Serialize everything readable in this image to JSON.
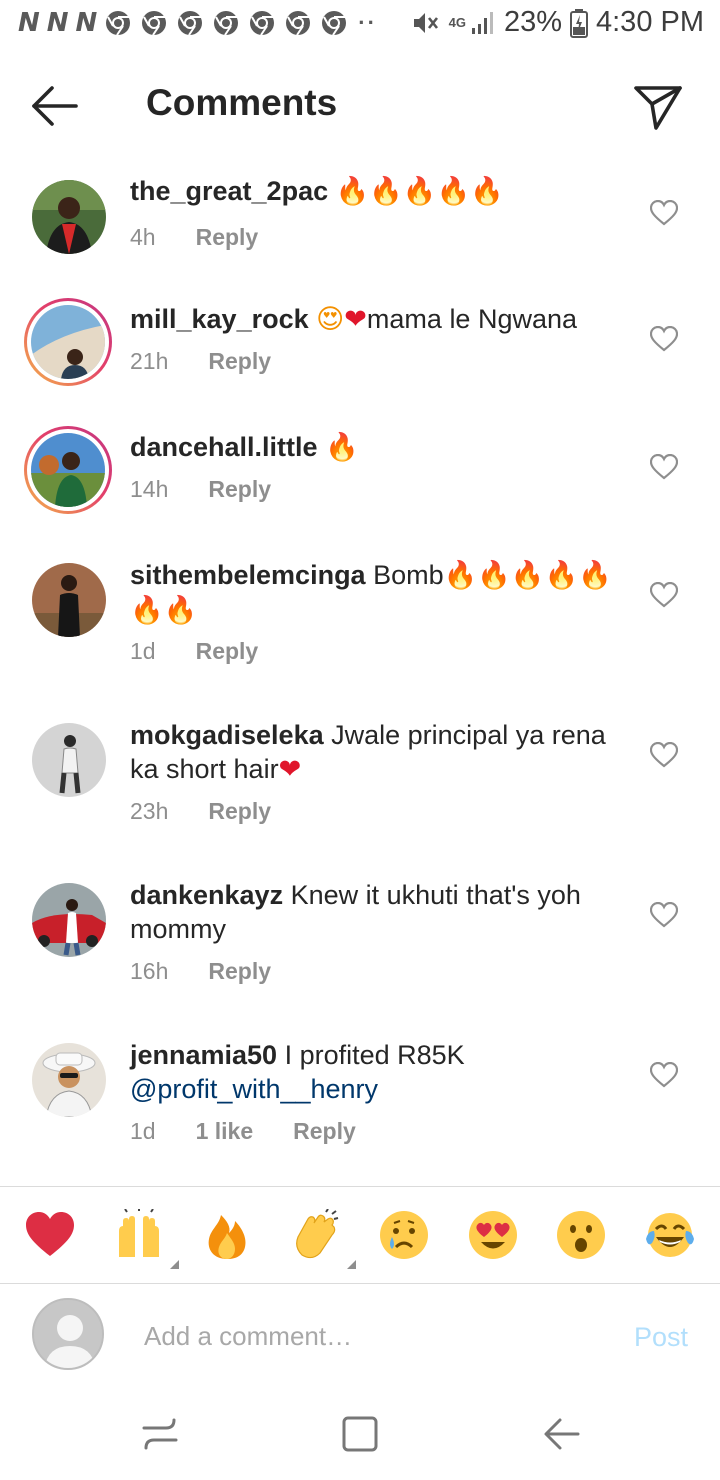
{
  "status_bar": {
    "notification_letters": [
      "N",
      "N",
      "N"
    ],
    "chrome_icon_count": 7,
    "network": "4G",
    "battery": "23%",
    "time": "4:30 PM"
  },
  "header": {
    "title": "Comments"
  },
  "comments": [
    {
      "username": "the_great_2pac",
      "text": "",
      "emoji": "🔥🔥🔥🔥🔥",
      "time": "4h",
      "reply": "Reply"
    },
    {
      "username": "mill_kay_rock",
      "text_pre_emoji": "😍",
      "heart": "❤",
      "text": "mama le Ngwana",
      "time": "21h",
      "reply": "Reply"
    },
    {
      "username": "dancehall.little",
      "text": "",
      "emoji": "🔥",
      "time": "14h",
      "reply": "Reply"
    },
    {
      "username": "sithembelemcinga",
      "text": "Bomb",
      "emoji": "🔥🔥🔥🔥🔥🔥🔥",
      "time": "1d",
      "reply": "Reply"
    },
    {
      "username": "mokgadiseleka",
      "text": "Jwale principal ya rena ka short hair",
      "heart": "❤",
      "time": "23h",
      "reply": "Reply"
    },
    {
      "username": "dankenkayz",
      "text": "Knew it ukhuti that's yoh mommy",
      "time": "16h",
      "reply": "Reply"
    },
    {
      "username": "jennamia50",
      "text": "I profited R85K",
      "mention": "@profit_with__henry",
      "time": "1d",
      "likes": "1 like",
      "reply": "Reply"
    }
  ],
  "emoji_bar": [
    "red-heart",
    "raising-hands",
    "fire",
    "clapping-hands",
    "crying-face",
    "heart-eyes-face",
    "surprised-face",
    "tears-of-joy-face"
  ],
  "composer": {
    "placeholder": "Add a comment…",
    "post_label": "Post"
  },
  "colors": {
    "text": "#262626",
    "meta": "#8e8e8e",
    "link": "#00376b",
    "post_disabled": "#b2dffc",
    "divider": "#dbdbdb"
  }
}
